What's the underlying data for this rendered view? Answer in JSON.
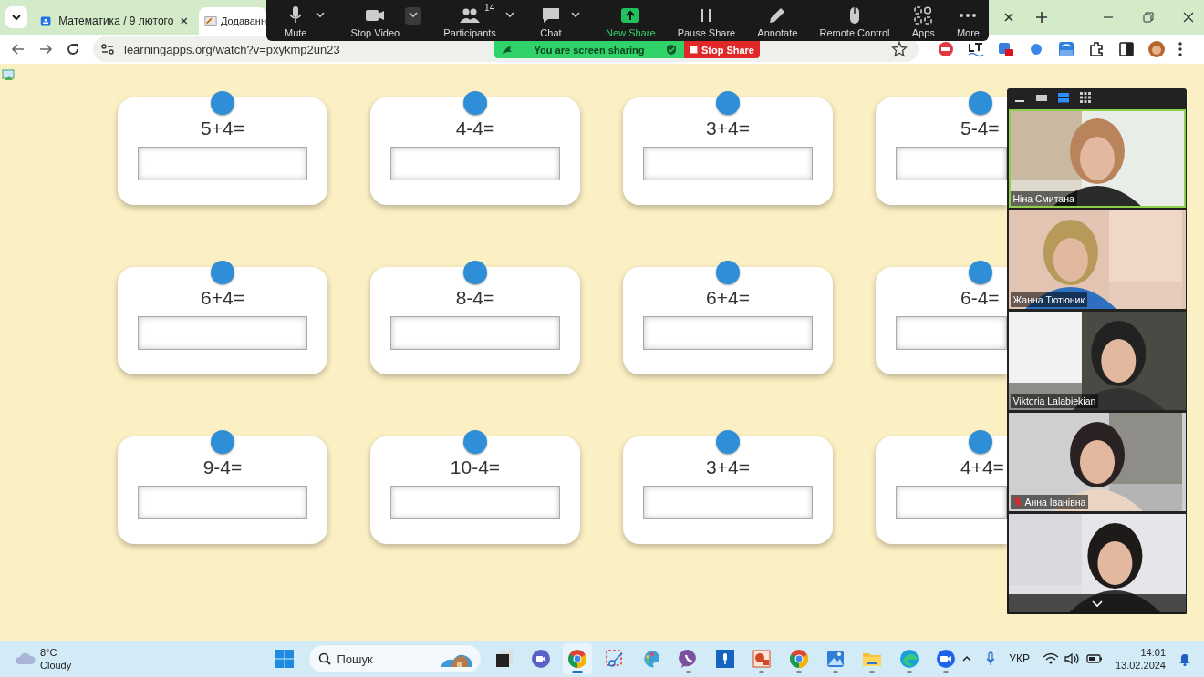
{
  "browser": {
    "tabs": [
      {
        "title": "Математика / 9 лютого",
        "kind": "classroom",
        "selected": false
      },
      {
        "title": "Додаванн",
        "kind": "apps",
        "selected": true
      }
    ],
    "address": "learningapps.org/watch?v=pxykmp2un23"
  },
  "zoom_toolbar": {
    "buttons": [
      {
        "label": "Mute",
        "kind": "mic",
        "caret": true
      },
      {
        "label": "Stop Video",
        "kind": "video",
        "caret": true
      },
      {
        "label": "Participants",
        "kind": "people",
        "count": "14",
        "caret": true
      },
      {
        "label": "Chat",
        "kind": "chat",
        "caret": true
      },
      {
        "label": "New Share",
        "kind": "share",
        "caret": false
      },
      {
        "label": "Pause Share",
        "kind": "pause",
        "caret": false
      },
      {
        "label": "Annotate",
        "kind": "pen",
        "caret": false
      },
      {
        "label": "Remote Control",
        "kind": "mouse",
        "caret": false
      },
      {
        "label": "Apps",
        "kind": "apps",
        "caret": false
      },
      {
        "label": "More",
        "kind": "more",
        "caret": false
      }
    ]
  },
  "share_banner": {
    "text": "You are screen sharing",
    "stop": "Stop Share"
  },
  "cards": [
    {
      "question": "5+4="
    },
    {
      "question": "4-4="
    },
    {
      "question": "3+4="
    },
    {
      "question": "5-4="
    },
    {
      "question": "6+4="
    },
    {
      "question": "8-4="
    },
    {
      "question": "6+4="
    },
    {
      "question": "6-4="
    },
    {
      "question": "9-4="
    },
    {
      "question": "10-4="
    },
    {
      "question": "3+4="
    },
    {
      "question": "4+4="
    }
  ],
  "video_panel": {
    "tiles": [
      {
        "name": "Ніна Смитана",
        "active": true,
        "muted": false
      },
      {
        "name": "Жанна Тютюник",
        "active": false,
        "muted": false
      },
      {
        "name": "Viktoria Lalabiekian",
        "active": false,
        "muted": false
      },
      {
        "name": "Анна Іванівна",
        "active": false,
        "muted": true
      },
      {
        "active": false,
        "muted": false
      }
    ]
  },
  "taskbar": {
    "weather": {
      "temp": "8°C",
      "condition": "Cloudy"
    },
    "search": {
      "placeholder": "Пошук"
    },
    "apps": [
      {
        "kind": "taskview",
        "running": false,
        "selected": false
      },
      {
        "kind": "meet",
        "running": false,
        "selected": false
      },
      {
        "kind": "chrome",
        "running": true,
        "selected": true
      },
      {
        "kind": "snip",
        "running": false,
        "selected": false
      },
      {
        "kind": "paint",
        "running": false,
        "selected": false
      },
      {
        "kind": "viber",
        "running": true,
        "selected": false
      },
      {
        "kind": "recorder",
        "running": false,
        "selected": false
      },
      {
        "kind": "powerpoint",
        "running": true,
        "selected": false
      },
      {
        "kind": "chrome",
        "running": true,
        "selected": false
      },
      {
        "kind": "photos",
        "running": true,
        "selected": false
      },
      {
        "kind": "folder",
        "running": true,
        "selected": false
      },
      {
        "kind": "edge",
        "running": true,
        "selected": false
      },
      {
        "kind": "zoom",
        "running": true,
        "selected": false
      }
    ],
    "language": "УКР",
    "time": "14:01",
    "date": "13.02.2024"
  }
}
